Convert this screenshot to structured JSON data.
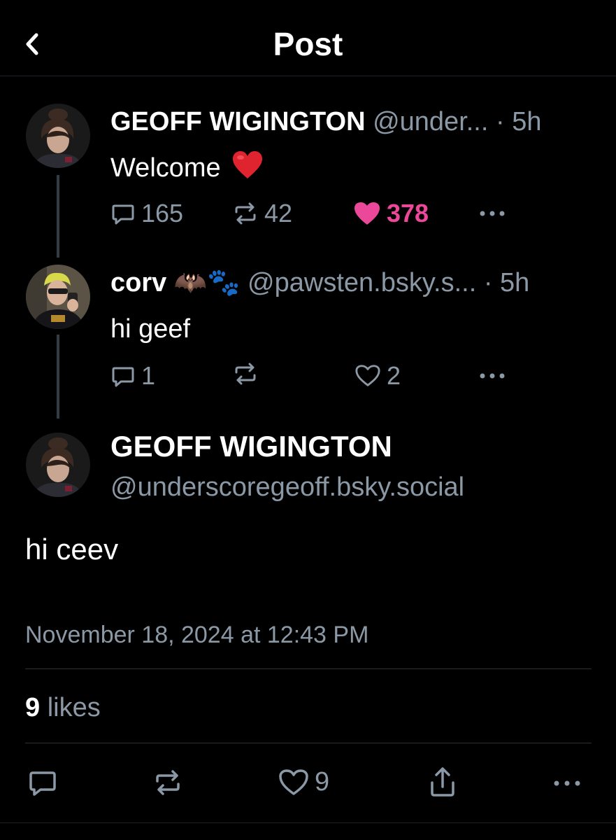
{
  "header": {
    "title": "Post"
  },
  "thread": [
    {
      "name": "GEOFF WIGINGTON",
      "handle": "@under...",
      "time": "· 5h",
      "text": "Welcome",
      "text_emoji": "❤️",
      "replies": "165",
      "reposts": "42",
      "likes": "378",
      "liked": true
    },
    {
      "name": "corv",
      "name_emoji": "🦇🐾",
      "handle": "@pawsten.bsky.s...",
      "time": "· 5h",
      "text": "hi geef",
      "replies": "1",
      "reposts": "",
      "likes": "2",
      "liked": false
    }
  ],
  "main_post": {
    "name": "GEOFF WIGINGTON",
    "handle": "@underscoregeoff.bsky.social",
    "text": "hi ceev",
    "timestamp": "November 18, 2024 at 12:43 PM",
    "likes_count": "9",
    "likes_label": "likes",
    "like_action_count": "9"
  },
  "colors": {
    "accent_like": "#ec4899",
    "muted": "#8b98a5",
    "background": "#000000"
  }
}
